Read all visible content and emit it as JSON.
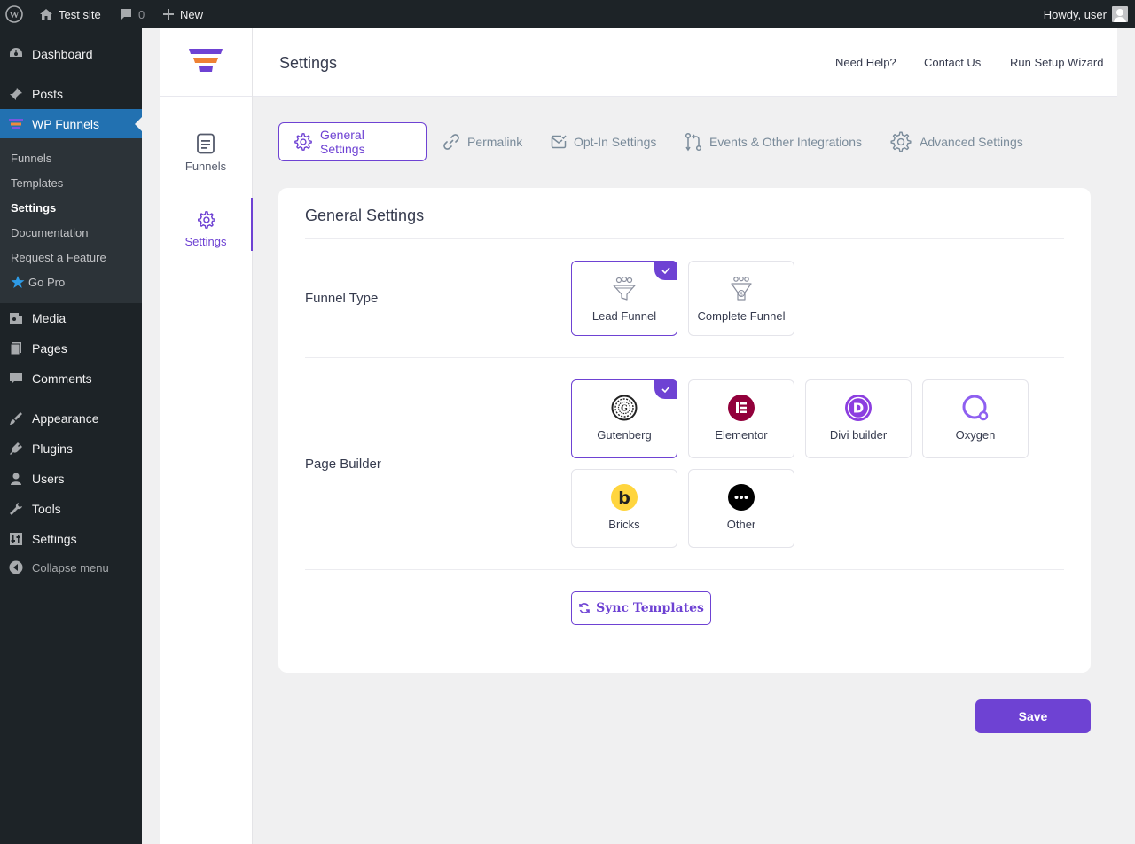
{
  "admin_bar": {
    "site_name": "Test site",
    "comments_count": "0",
    "new_label": "New",
    "greeting": "Howdy, user"
  },
  "wp_menu": {
    "items": [
      {
        "label": "Dashboard",
        "icon": "dashboard-icon"
      },
      {
        "label": "Posts",
        "icon": "pin-icon"
      },
      {
        "label": "WP Funnels",
        "icon": "funnel-icon"
      },
      {
        "label": "Media",
        "icon": "media-icon"
      },
      {
        "label": "Pages",
        "icon": "pages-icon"
      },
      {
        "label": "Comments",
        "icon": "comment-icon"
      },
      {
        "label": "Appearance",
        "icon": "brush-icon"
      },
      {
        "label": "Plugins",
        "icon": "plug-icon"
      },
      {
        "label": "Users",
        "icon": "user-icon"
      },
      {
        "label": "Tools",
        "icon": "wrench-icon"
      },
      {
        "label": "Settings",
        "icon": "sliders-icon"
      }
    ],
    "submenu": [
      "Funnels",
      "Templates",
      "Settings",
      "Documentation",
      "Request a Feature",
      "Go Pro"
    ],
    "collapse_label": "Collapse menu"
  },
  "plugin_nav": {
    "items": [
      {
        "label": "Funnels",
        "icon": "document-icon"
      },
      {
        "label": "Settings",
        "icon": "gear-icon"
      }
    ]
  },
  "header": {
    "title": "Settings",
    "links": [
      "Need Help?",
      "Contact Us",
      "Run Setup Wizard"
    ]
  },
  "tabs": [
    "General Settings",
    "Permalink",
    "Opt-In Settings",
    "Events & Other Integrations",
    "Advanced Settings"
  ],
  "active_tab": "General Settings",
  "card": {
    "title": "General Settings",
    "funnel_type": {
      "label": "Funnel Type",
      "options": [
        "Lead Funnel",
        "Complete Funnel"
      ],
      "selected": "Lead Funnel"
    },
    "page_builder": {
      "label": "Page Builder",
      "options": [
        "Gutenberg",
        "Elementor",
        "Divi builder",
        "Oxygen",
        "Bricks",
        "Other"
      ],
      "selected": "Gutenberg"
    },
    "sync_label": "Sync Templates"
  },
  "save_label": "Save",
  "colors": {
    "accent": "#6e42d3",
    "wp_dark": "#1d2327",
    "wp_blue": "#2271b1",
    "elementor": "#92003b",
    "divi": "#8c3ee0",
    "bricks": "#ffd53e"
  }
}
